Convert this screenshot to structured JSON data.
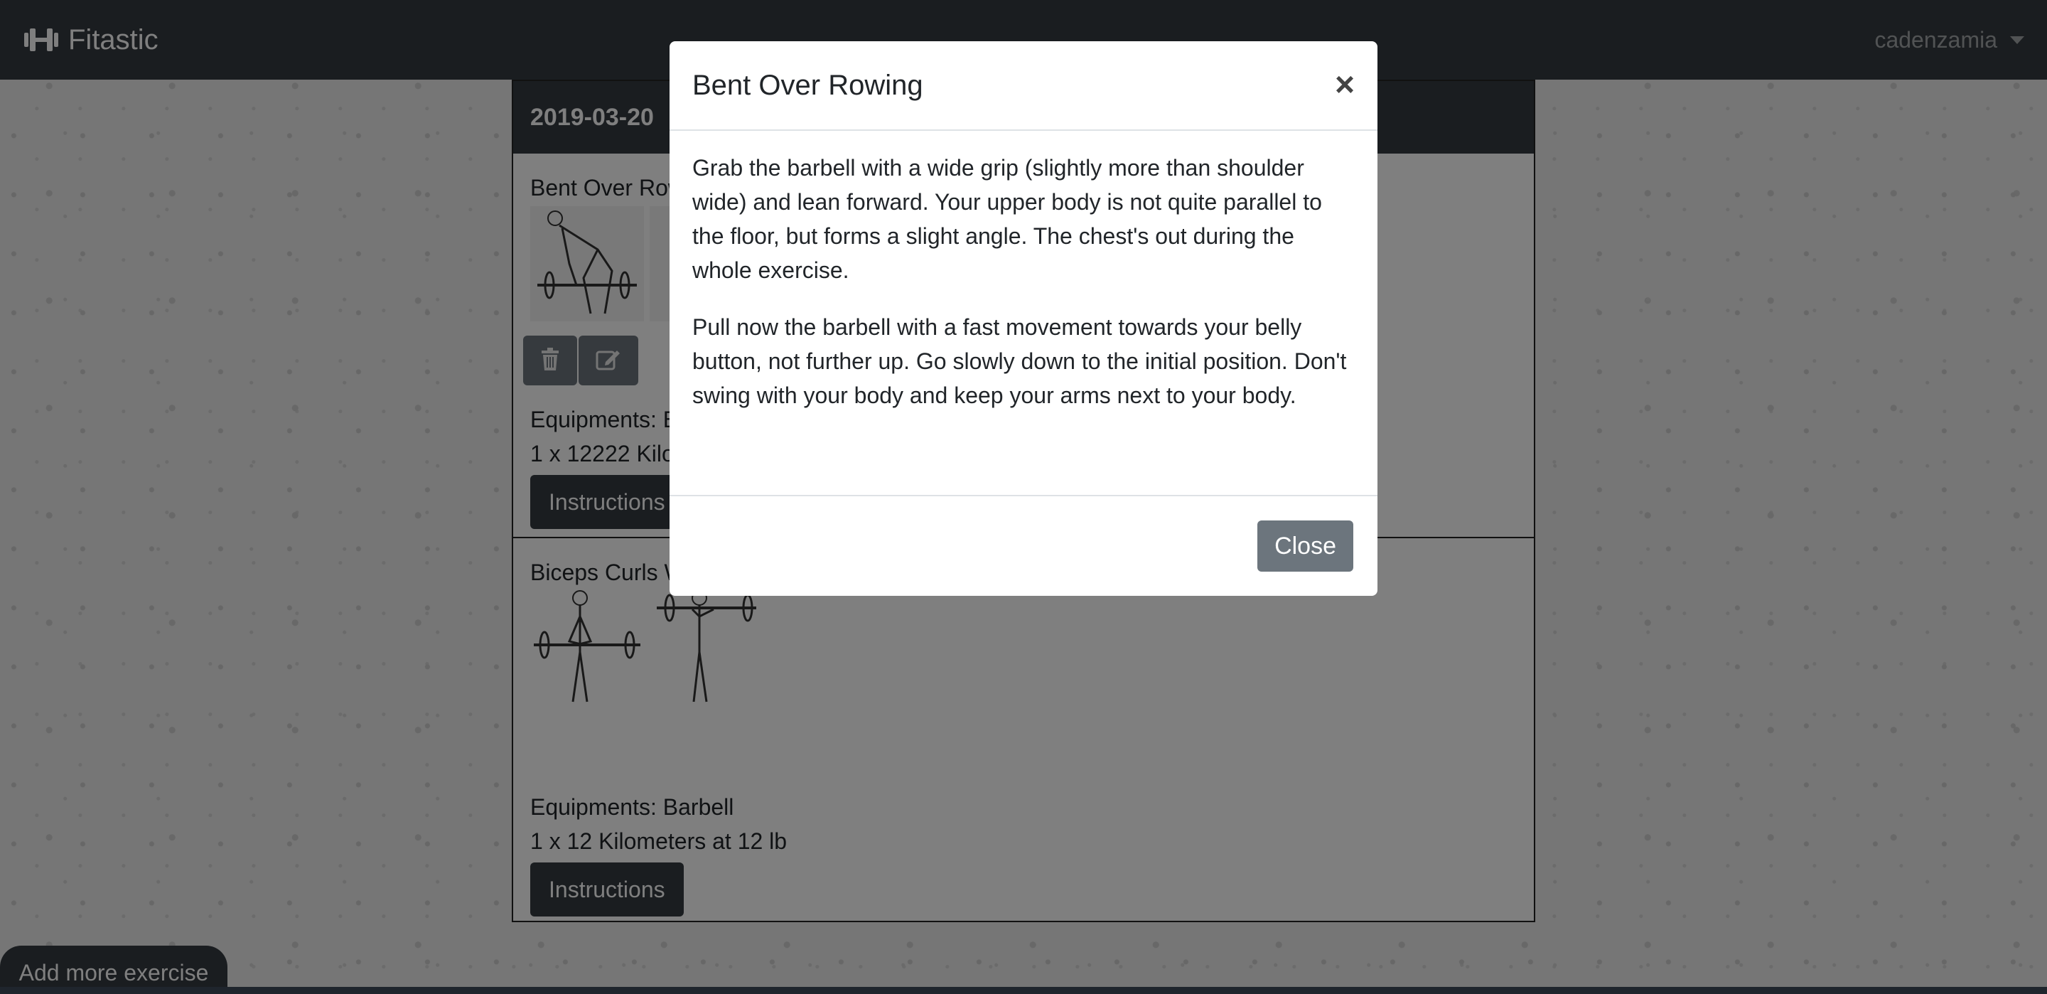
{
  "navbar": {
    "brand": "Fitastic",
    "brand_icon": "dumbbell-icon",
    "username": "cadenzamia"
  },
  "workout": {
    "date": "2019-03-20",
    "exercises": [
      {
        "name": "Bent Over Rowing",
        "equipment": "Equipments: Barbell",
        "sets": "1 x 12222 Kilometers",
        "instructions_label": "Instructions"
      },
      {
        "name": "Biceps Curls With Barbell",
        "equipment": "Equipments: Barbell",
        "sets": "1 x 12 Kilometers at 12 lb",
        "instructions_label": "Instructions"
      }
    ]
  },
  "add_more_label": "Add more exercise",
  "modal": {
    "title": "Bent Over Rowing",
    "close_x": "×",
    "paragraphs": [
      "Grab the barbell with a wide grip (slightly more than shoulder wide) and lean forward. Your upper body is not quite parallel to the floor, but forms a slight angle. The chest's out during the whole exercise.",
      "Pull now the barbell with a fast movement towards your belly button, not further up. Go slowly down to the initial position. Don't swing with your body and keep your arms next to your body."
    ],
    "close_label": "Close"
  },
  "colors": {
    "navbar": "#343a40",
    "secondary_button": "#6c757d",
    "dark_button": "#343a40"
  }
}
